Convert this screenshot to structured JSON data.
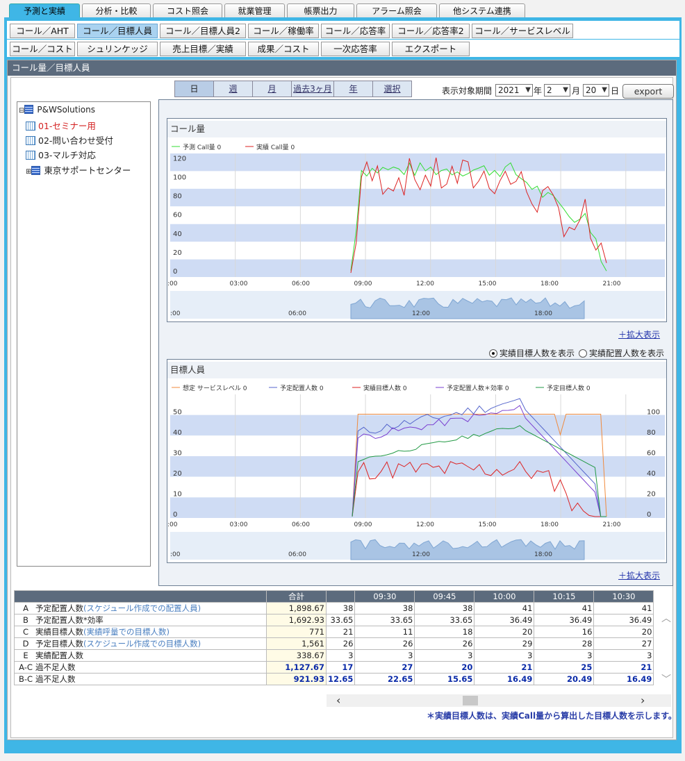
{
  "top_tabs": [
    "予測と実績",
    "分析・比較",
    "コスト照会",
    "就業管理",
    "帳票出力",
    "アラーム照会",
    "他システム連携"
  ],
  "sub_tabs_row1": [
    "コール／AHT",
    "コール／目標人員",
    "コール／目標人員2",
    "コール／稼働率",
    "コール／応答率",
    "コール／応答率2",
    "コール／サービスレベル"
  ],
  "sub_tabs_row2": [
    "コール／コスト",
    "シュリンケッジ",
    "売上目標／実績",
    "成果／コスト",
    "一次応答率",
    "エクスポート"
  ],
  "panel_title": "コール量／目標人員",
  "period_buttons": [
    "日",
    "週",
    "月",
    "過去3ヶ月",
    "年",
    "選択"
  ],
  "period_label": "表示対象期間",
  "date": {
    "year": "2021",
    "year_unit": "年",
    "month": "2",
    "month_unit": "月",
    "day": "20",
    "day_unit": "日"
  },
  "export_label": "export",
  "tree": {
    "root": "P&WSolutions",
    "items": [
      "01-セミナー用",
      "02-問い合わせ受付",
      "03-マルチ対応"
    ],
    "group": "東京サポートセンター"
  },
  "call_chart": {
    "title": "コール量",
    "legend": [
      "予測 Call量 0",
      "実績 Call量 0"
    ],
    "series_colors": [
      "#33dd33",
      "#dd2222"
    ],
    "x_ticks": [
      ":00",
      "03:00",
      "06:00",
      "09:00",
      "12:00",
      "15:00",
      "18:00",
      "21:00"
    ],
    "y_ticks": [
      "0",
      "20",
      "40",
      "60",
      "80",
      "100",
      "120"
    ],
    "nav_ticks": [
      ":00",
      "06:00",
      "12:00",
      "18:00"
    ]
  },
  "expand_label": "＋拡大表示",
  "radio": {
    "option1": "実績目標人数を表示",
    "option2": "実績配置人数を表示"
  },
  "staff_chart": {
    "title": "目標人員",
    "legend": [
      "想定 サービスレベル 0",
      "予定配置人数 0",
      "実績目標人数 0",
      "予定配置人数＊効率 0",
      "予定目標人数 0"
    ],
    "series_colors": [
      "#f08a3c",
      "#5566cc",
      "#dd2222",
      "#7a3fd0",
      "#229944"
    ],
    "x_ticks": [
      ":00",
      "03:00",
      "06:00",
      "09:00",
      "12:00",
      "15:00",
      "18:00",
      "21:00"
    ],
    "y_left": [
      "0",
      "10",
      "20",
      "30",
      "40",
      "50"
    ],
    "y_right": [
      "0",
      "20",
      "40",
      "60",
      "80",
      "100"
    ],
    "nav_ticks": [
      ":00",
      "06:00",
      "12:00",
      "18:00"
    ]
  },
  "table": {
    "headers": [
      "",
      "合計",
      "",
      "09:30",
      "09:45",
      "10:00",
      "10:15",
      "10:30"
    ],
    "rows": [
      {
        "code": "A",
        "label": "予定配置人数",
        "sub": "(スケジュール作成での配置人員)",
        "total": "1,898.67",
        "v": [
          "38",
          "38",
          "38",
          "41",
          "41",
          "41"
        ],
        "bold": false
      },
      {
        "code": "B",
        "label": "予定配置人数*効率",
        "sub": "",
        "total": "1,692.93",
        "v": [
          "33.65",
          "33.65",
          "33.65",
          "36.49",
          "36.49",
          "36.49"
        ],
        "bold": false
      },
      {
        "code": "C",
        "label": "実績目標人数",
        "sub": "(実績呼量での目標人数)",
        "total": "771",
        "v": [
          "21",
          "11",
          "18",
          "20",
          "16",
          "20"
        ],
        "bold": false
      },
      {
        "code": "D",
        "label": "予定目標人数",
        "sub": "(スケジュール作成での目標人数)",
        "total": "1,561",
        "v": [
          "26",
          "26",
          "26",
          "29",
          "28",
          "27"
        ],
        "bold": false
      },
      {
        "code": "E",
        "label": "実績配置人数",
        "sub": "",
        "total": "338.67",
        "v": [
          "3",
          "3",
          "3",
          "3",
          "3",
          "3"
        ],
        "bold": false
      },
      {
        "code": "A-C",
        "label": "過不足人数",
        "sub": "",
        "total": "1,127.67",
        "v": [
          "17",
          "27",
          "20",
          "21",
          "25",
          "21"
        ],
        "bold": true
      },
      {
        "code": "B-C",
        "label": "過不足人数",
        "sub": "",
        "total": "921.93",
        "v": [
          "12.65",
          "22.65",
          "15.65",
          "16.49",
          "20.49",
          "16.49"
        ],
        "bold": true
      }
    ]
  },
  "footnote": "＊実績目標人数は、実績Call量から算出した目標人数を示します。"
}
